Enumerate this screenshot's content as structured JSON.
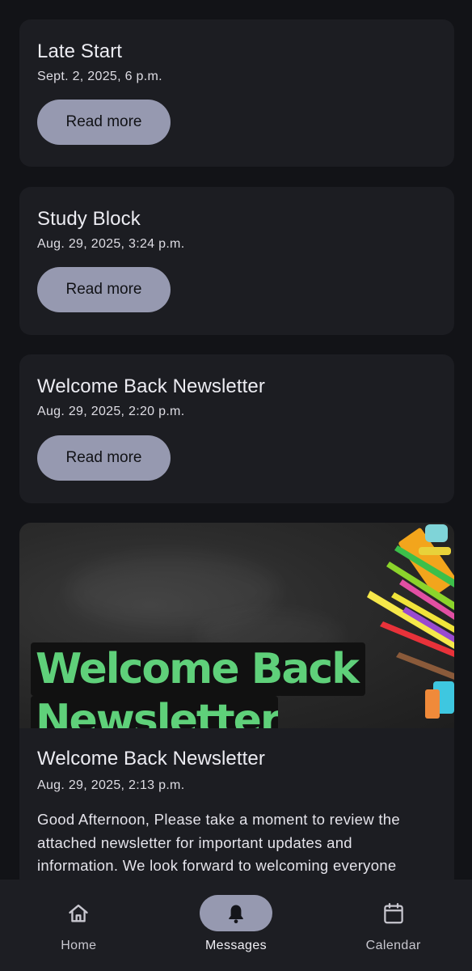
{
  "feed": {
    "items": [
      {
        "title": "Late Start",
        "date": "Sept. 2, 2025, 6 p.m.",
        "button": "Read more"
      },
      {
        "title": "Study Block",
        "date": "Aug. 29, 2025, 3:24 p.m.",
        "button": "Read more"
      },
      {
        "title": "Welcome Back Newsletter",
        "date": "Aug. 29, 2025, 2:20 p.m.",
        "button": "Read more"
      },
      {
        "title": "Welcome Back Newsletter",
        "date": "Aug. 29, 2025, 2:13 p.m.",
        "banner_line1": "Welcome Back",
        "banner_line2": "Newsletter",
        "body": "Good Afternoon,  Please take a moment to review the attached newsletter for important updates and information.  We look forward to welcoming everyone"
      }
    ]
  },
  "nav": {
    "items": [
      {
        "label": "Home",
        "icon": "home-icon",
        "active": false
      },
      {
        "label": "Messages",
        "icon": "bell-icon",
        "active": true
      },
      {
        "label": "Calendar",
        "icon": "calendar-icon",
        "active": false
      }
    ]
  },
  "colors": {
    "background": "#121317",
    "card": "#1c1d22",
    "button": "#9699b0",
    "banner_text": "#5fd07a"
  }
}
